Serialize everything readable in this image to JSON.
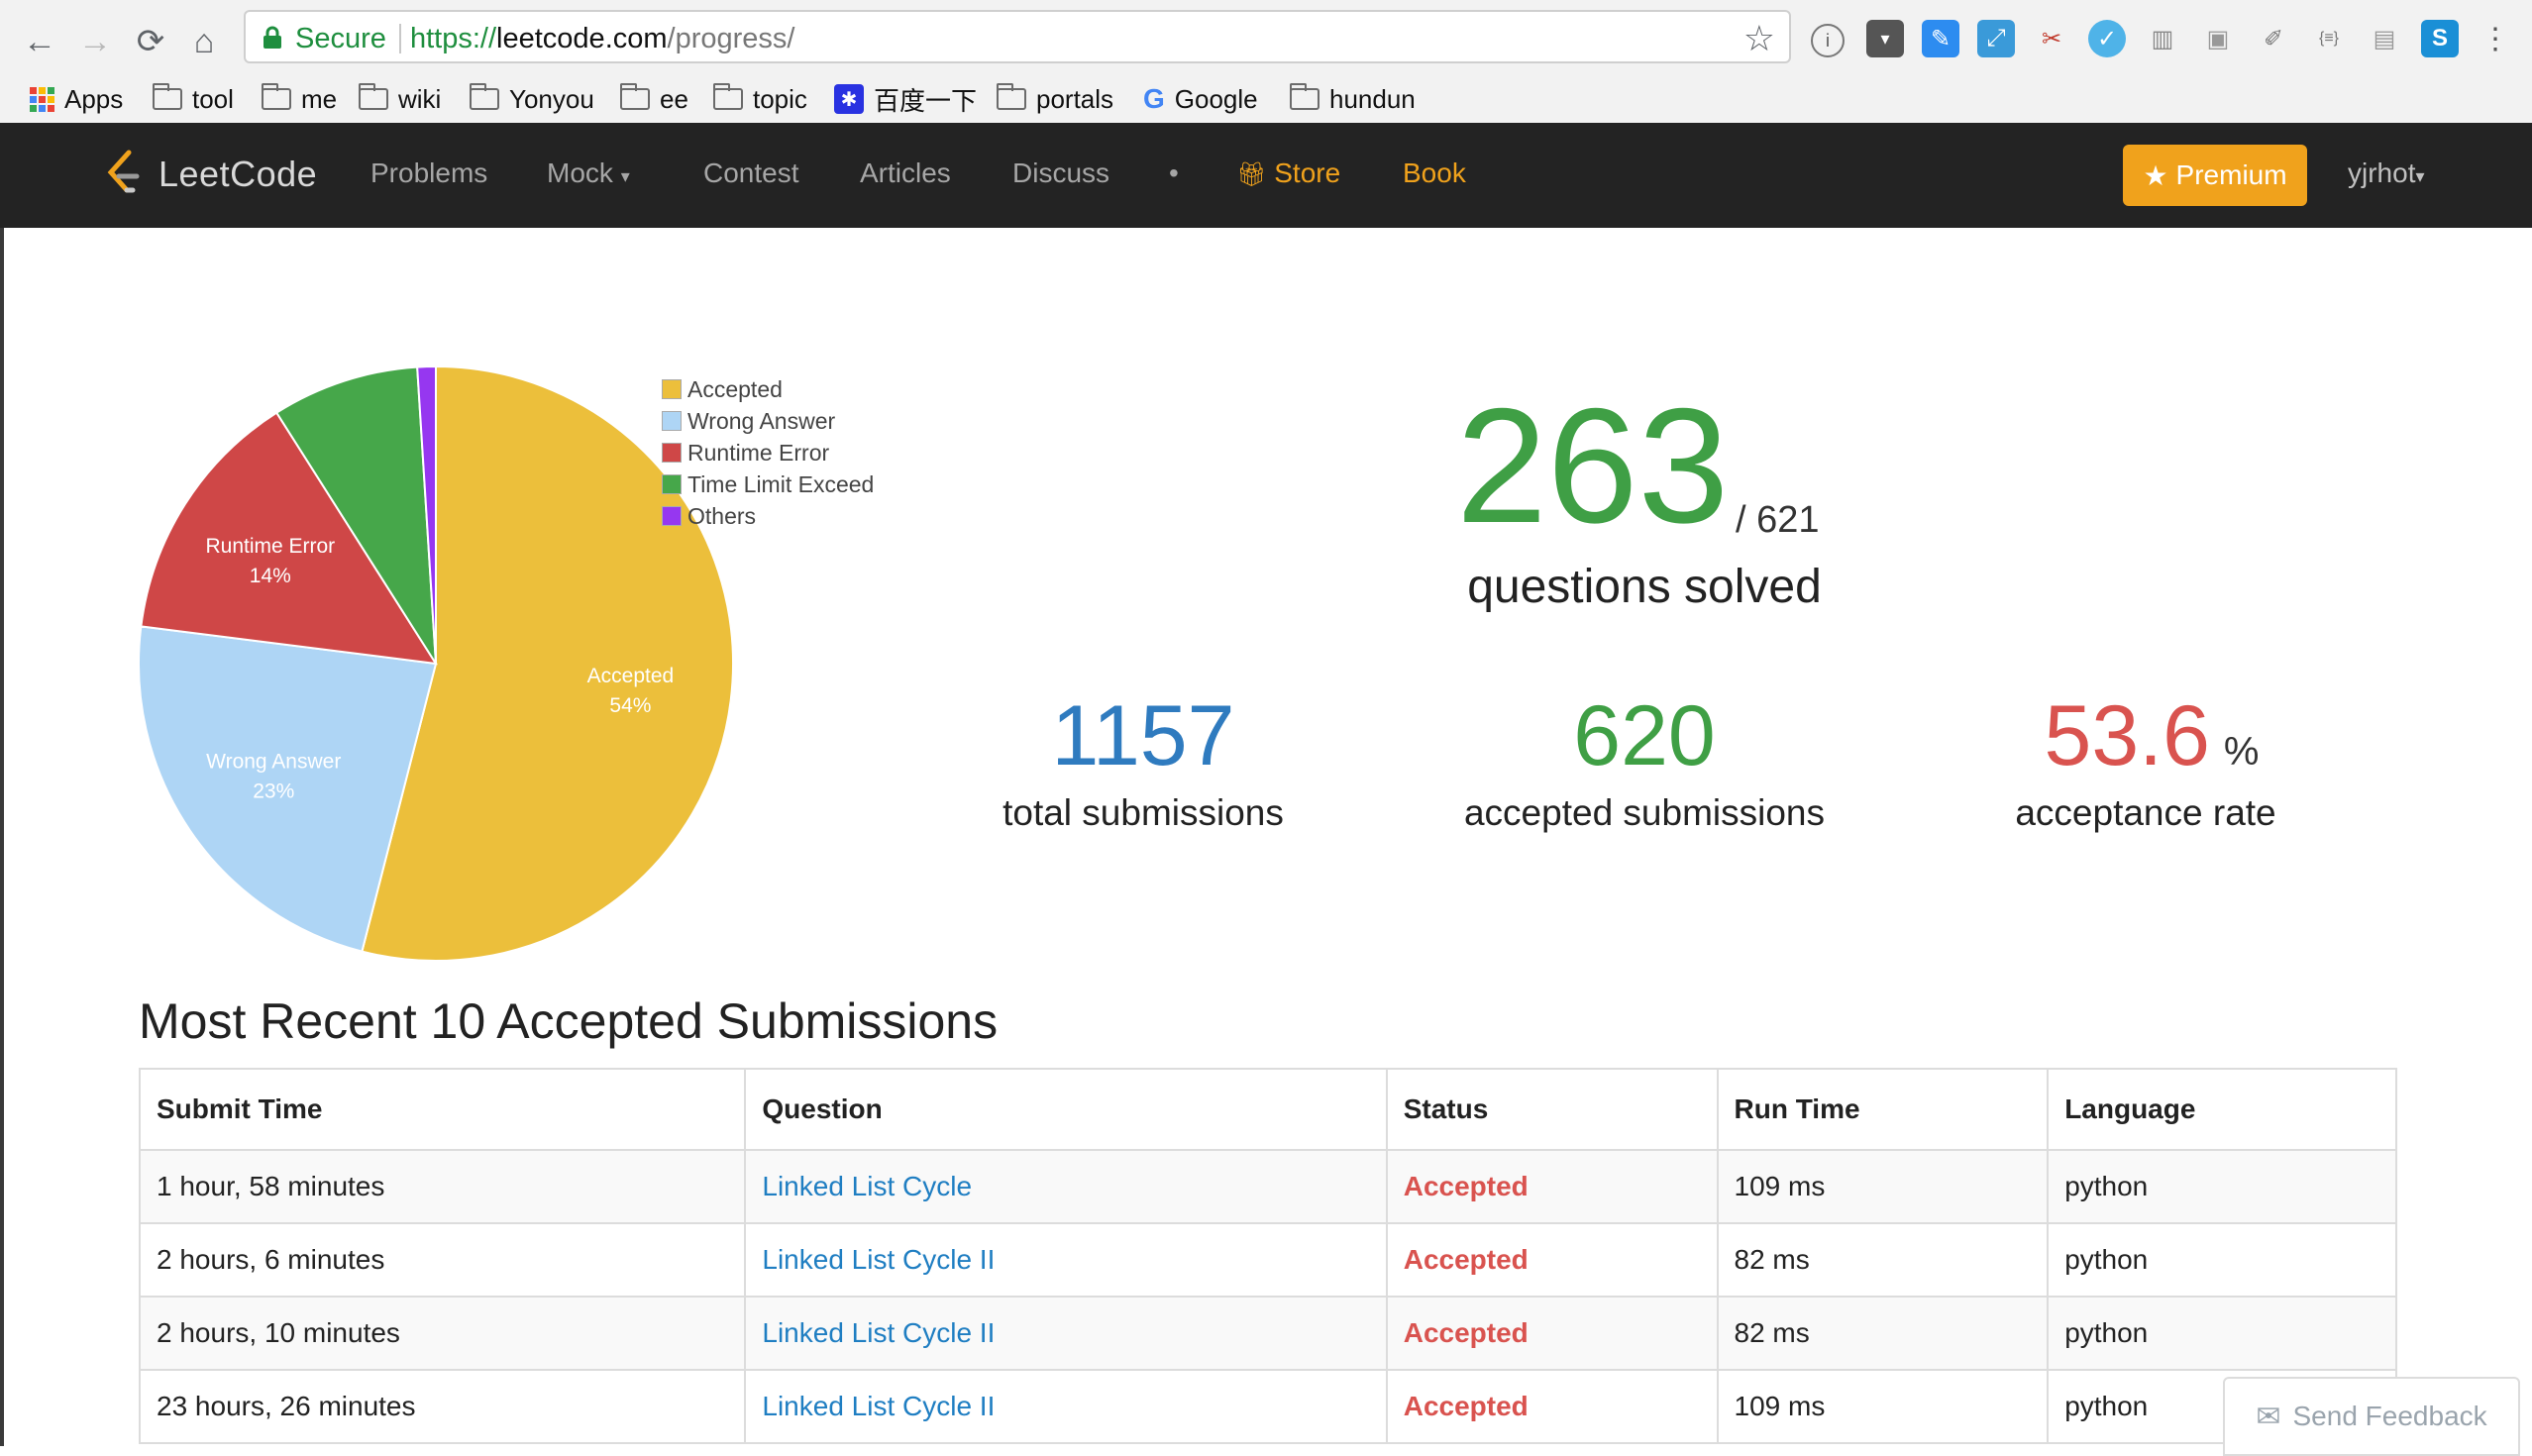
{
  "browser": {
    "secure_label": "Secure",
    "url_scheme": "https://",
    "url_host": "leetcode.com",
    "url_path": "/progress/",
    "bookmarks": [
      {
        "label": "Apps",
        "icon": "apps-grid-icon"
      },
      {
        "label": "tool",
        "icon": "folder-icon"
      },
      {
        "label": "me",
        "icon": "folder-icon"
      },
      {
        "label": "wiki",
        "icon": "folder-icon"
      },
      {
        "label": "Yonyou",
        "icon": "folder-icon"
      },
      {
        "label": "ee",
        "icon": "folder-icon"
      },
      {
        "label": "topic",
        "icon": "folder-icon"
      },
      {
        "label": "百度一下",
        "icon": "baidu-paw-icon"
      },
      {
        "label": "portals",
        "icon": "folder-icon"
      },
      {
        "label": "Google",
        "icon": "google-g-icon"
      },
      {
        "label": "hundun",
        "icon": "folder-icon"
      }
    ]
  },
  "nav": {
    "logo_text": "LeetCode",
    "items": [
      "Problems",
      "Mock",
      "Contest",
      "Articles",
      "Discuss"
    ],
    "dot": "•",
    "store": "Store",
    "book": "Book",
    "premium": "Premium",
    "user": "yjrhot"
  },
  "stats": {
    "solved": "263",
    "total_questions": "/ 621",
    "solved_label": "questions solved",
    "total_submissions": "1157",
    "total_submissions_label": "total submissions",
    "accepted_submissions": "620",
    "accepted_submissions_label": "accepted submissions",
    "acceptance_rate": "53.6",
    "acceptance_rate_unit": "%",
    "acceptance_rate_label": "acceptance rate"
  },
  "chart_data": {
    "type": "pie",
    "categories": [
      "Accepted",
      "Wrong Answer",
      "Runtime Error",
      "Time Limit Exceed",
      "Others"
    ],
    "values": [
      54,
      23,
      14,
      8,
      1
    ],
    "slice_labels": [
      {
        "name": "Accepted",
        "pct": "54%"
      },
      {
        "name": "Wrong Answer",
        "pct": "23%"
      },
      {
        "name": "Runtime Error",
        "pct": "14%"
      },
      null,
      null
    ],
    "colors": [
      "#ecbf3b",
      "#aed5f5",
      "#cf4747",
      "#46a74a",
      "#9637f0"
    ],
    "legend_position": "top-right"
  },
  "recent": {
    "heading": "Most Recent 10 Accepted Submissions",
    "columns": [
      "Submit Time",
      "Question",
      "Status",
      "Run Time",
      "Language"
    ],
    "rows": [
      {
        "time": "1 hour, 58 minutes",
        "question": "Linked List Cycle",
        "status": "Accepted",
        "runtime": "109 ms",
        "language": "python"
      },
      {
        "time": "2 hours, 6 minutes",
        "question": "Linked List Cycle II",
        "status": "Accepted",
        "runtime": "82 ms",
        "language": "python"
      },
      {
        "time": "2 hours, 10 minutes",
        "question": "Linked List Cycle II",
        "status": "Accepted",
        "runtime": "82 ms",
        "language": "python"
      },
      {
        "time": "23 hours, 26 minutes",
        "question": "Linked List Cycle II",
        "status": "Accepted",
        "runtime": "109 ms",
        "language": "python"
      }
    ]
  },
  "feedback": "Send Feedback",
  "colors": {
    "accent_green": "#3f9f45",
    "accent_blue": "#2f7bbf",
    "accent_red": "#d9534f",
    "brand_orange": "#f0a21c"
  }
}
